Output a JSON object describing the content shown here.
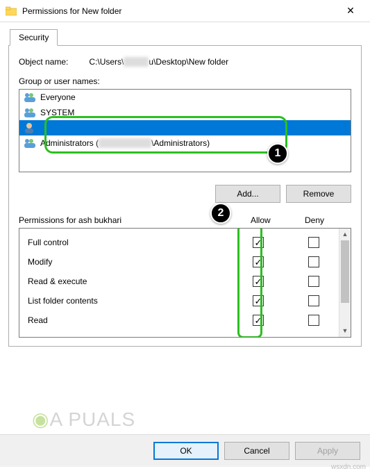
{
  "window": {
    "title": "Permissions for New folder"
  },
  "tab": {
    "label": "Security"
  },
  "object": {
    "label": "Object name:",
    "path_prefix": "C:\\Users\\",
    "path_suffix": "u\\Desktop\\New folder"
  },
  "groups": {
    "label": "Group or user names:",
    "items": [
      {
        "name": "Everyone",
        "type": "group",
        "selected": false
      },
      {
        "name": "SYSTEM",
        "type": "group",
        "selected": false
      },
      {
        "name": "",
        "type": "user",
        "selected": true,
        "obscured": true
      },
      {
        "name_prefix": "Administrators (",
        "name_suffix": "\\Administrators)",
        "type": "group",
        "selected": false,
        "partially_obscured": true
      }
    ]
  },
  "buttons": {
    "add": "Add...",
    "remove": "Remove",
    "ok": "OK",
    "cancel": "Cancel",
    "apply": "Apply"
  },
  "permissions": {
    "label": "Permissions for ash bukhari",
    "allow_header": "Allow",
    "deny_header": "Deny",
    "rows": [
      {
        "name": "Full control",
        "allow": true,
        "deny": false
      },
      {
        "name": "Modify",
        "allow": true,
        "deny": false
      },
      {
        "name": "Read & execute",
        "allow": true,
        "deny": false
      },
      {
        "name": "List folder contents",
        "allow": true,
        "deny": false
      },
      {
        "name": "Read",
        "allow": true,
        "deny": false
      }
    ]
  },
  "annotations": {
    "marker1": "1",
    "marker2": "2"
  },
  "watermark": "A  PUALS",
  "sitemark": "wsxdn.com"
}
